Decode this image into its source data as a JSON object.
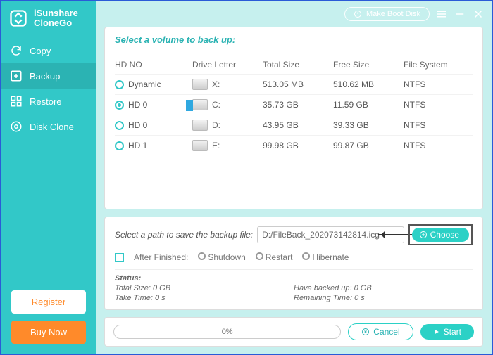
{
  "app": {
    "name1": "iSunshare",
    "name2": "CloneGo"
  },
  "nav": {
    "copy": "Copy",
    "backup": "Backup",
    "restore": "Restore",
    "diskclone": "Disk Clone"
  },
  "sidebar_buttons": {
    "register": "Register",
    "buy": "Buy Now"
  },
  "titlebar": {
    "boot": "Make Boot Disk"
  },
  "section_title": "Select a volume to back up:",
  "cols": {
    "hdno": "HD NO",
    "drive": "Drive Letter",
    "total": "Total Size",
    "free": "Free Size",
    "fs": "File System"
  },
  "rows": [
    {
      "sel": false,
      "name": "Dynamic",
      "letter": "X:",
      "total": "513.05 MB",
      "free": "510.62 MB",
      "fs": "NTFS",
      "win": false
    },
    {
      "sel": true,
      "name": "HD 0",
      "letter": "C:",
      "total": "35.73 GB",
      "free": "11.59 GB",
      "fs": "NTFS",
      "win": true
    },
    {
      "sel": false,
      "name": "HD 0",
      "letter": "D:",
      "total": "43.95 GB",
      "free": "39.33 GB",
      "fs": "NTFS",
      "win": false
    },
    {
      "sel": false,
      "name": "HD 1",
      "letter": "E:",
      "total": "99.98 GB",
      "free": "99.87 GB",
      "fs": "NTFS",
      "win": false
    }
  ],
  "path": {
    "label": "Select a path to save the backup file:",
    "value": "D:/FileBack_202073142814.icg",
    "choose": "Choose"
  },
  "after": {
    "label": "After Finished:",
    "shutdown": "Shutdown",
    "restart": "Restart",
    "hibernate": "Hibernate"
  },
  "status": {
    "heading": "Status:",
    "total": "Total Size: 0 GB",
    "taketime": "Take Time: 0 s",
    "backed": "Have backed up: 0 GB",
    "remain": "Remaining Time: 0 s"
  },
  "actions": {
    "progress": "0%",
    "cancel": "Cancel",
    "start": "Start"
  }
}
